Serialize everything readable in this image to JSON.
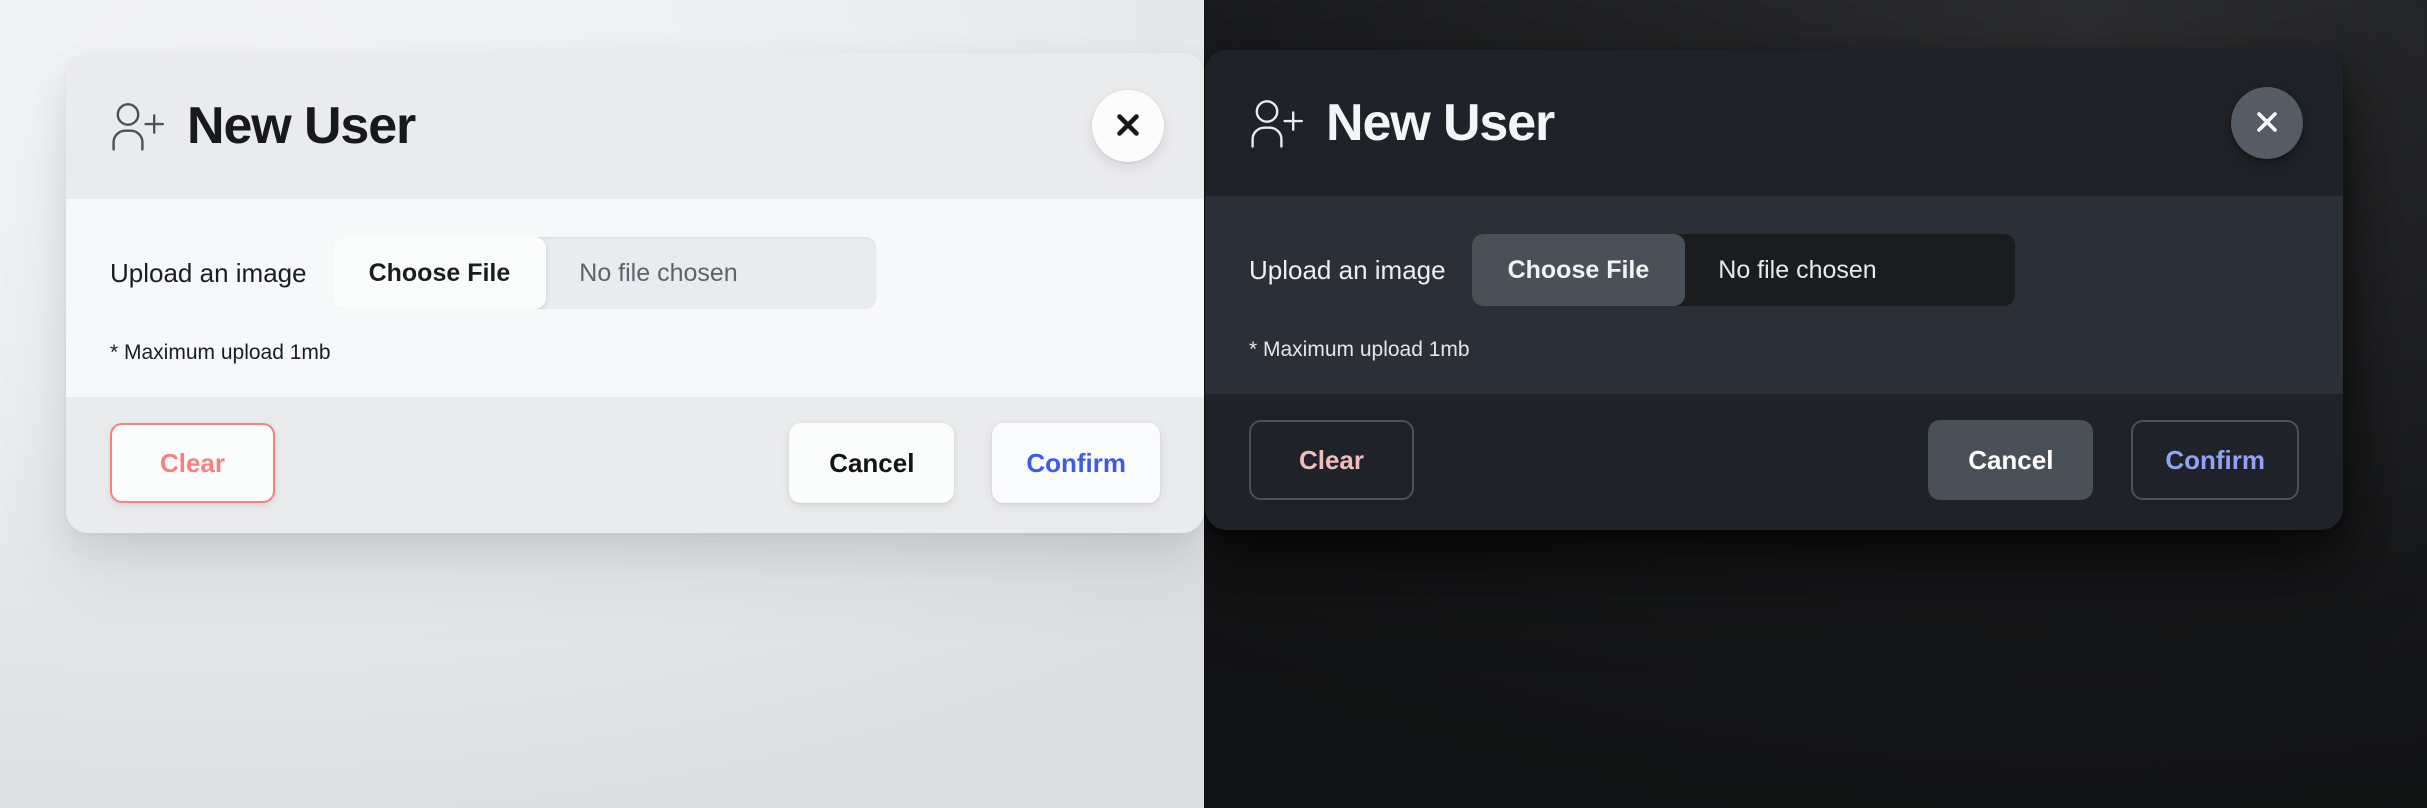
{
  "themes": {
    "light": {
      "header": {
        "icon": "user-plus-icon",
        "title": "New User",
        "close_icon": "close-icon"
      },
      "body": {
        "upload_label": "Upload an image",
        "choose_file_label": "Choose File",
        "file_status": "No file chosen",
        "hint": "* Maximum upload 1mb"
      },
      "footer": {
        "clear_label": "Clear",
        "cancel_label": "Cancel",
        "confirm_label": "Confirm"
      },
      "colors": {
        "header_bg": "#eaebed",
        "body_bg": "#f7f8f9",
        "footer_bg": "#eaebed",
        "title": "#17191d",
        "clear_accent": "#fa8080",
        "cancel_accent": "#111318",
        "confirm_accent": "#3b5bf0",
        "page_bg": "#e8e9eb"
      }
    },
    "dark": {
      "header": {
        "icon": "user-plus-icon",
        "title": "New User",
        "close_icon": "close-icon"
      },
      "body": {
        "upload_label": "Upload an image",
        "choose_file_label": "Choose File",
        "file_status": "No file chosen",
        "hint": "* Maximum upload 1mb"
      },
      "footer": {
        "clear_label": "Clear",
        "cancel_label": "Cancel",
        "confirm_label": "Confirm"
      },
      "colors": {
        "header_bg": "#1f2228",
        "body_bg": "#2b3038",
        "footer_bg": "#1f2228",
        "title": "#f4f5f6",
        "file_field_bg": "#1a1c20",
        "choose_file_bg": "#4a5058",
        "clear_accent": "#f1bcbc",
        "cancel_accent": "#ffffff",
        "confirm_accent": "#8fa3f7",
        "page_bg": "#17181a"
      }
    }
  }
}
